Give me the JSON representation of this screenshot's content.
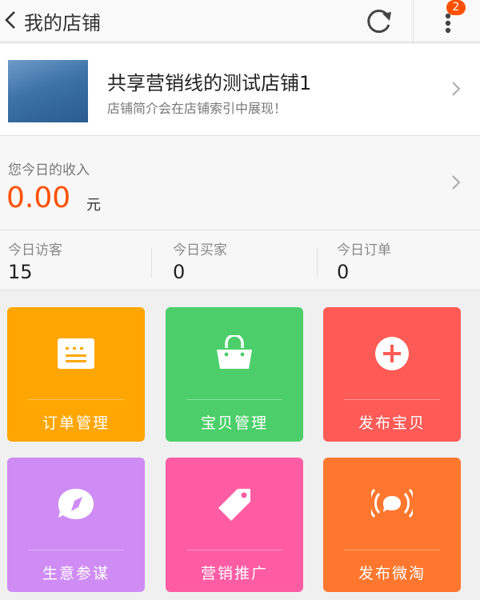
{
  "header": {
    "title": "我的店铺",
    "badge_count": "2"
  },
  "shop": {
    "name": "共享营销线的测试店铺1",
    "description": "店铺简介会在店铺索引中展现！"
  },
  "income": {
    "label": "您今日的收入",
    "amount": "0.00",
    "unit": "元"
  },
  "stats": [
    {
      "label": "今日访客",
      "value": "15"
    },
    {
      "label": "今日买家",
      "value": "0"
    },
    {
      "label": "今日订单",
      "value": "0"
    }
  ],
  "tiles": [
    {
      "label": "订单管理",
      "icon": "order-list-icon",
      "color": "#ffa602"
    },
    {
      "label": "宝贝管理",
      "icon": "shopping-bag-icon",
      "color": "#4ccf6a"
    },
    {
      "label": "发布宝贝",
      "icon": "plus-circle-icon",
      "color": "#fe5a56"
    },
    {
      "label": "生意参谋",
      "icon": "compass-chat-icon",
      "color": "#cf8cf4"
    },
    {
      "label": "营销推广",
      "icon": "price-tag-icon",
      "color": "#ff5ca3"
    },
    {
      "label": "发布微淘",
      "icon": "broadcast-icon",
      "color": "#ff772e"
    }
  ],
  "colors": {
    "accent": "#ff5000",
    "background": "#f0f0f0"
  }
}
